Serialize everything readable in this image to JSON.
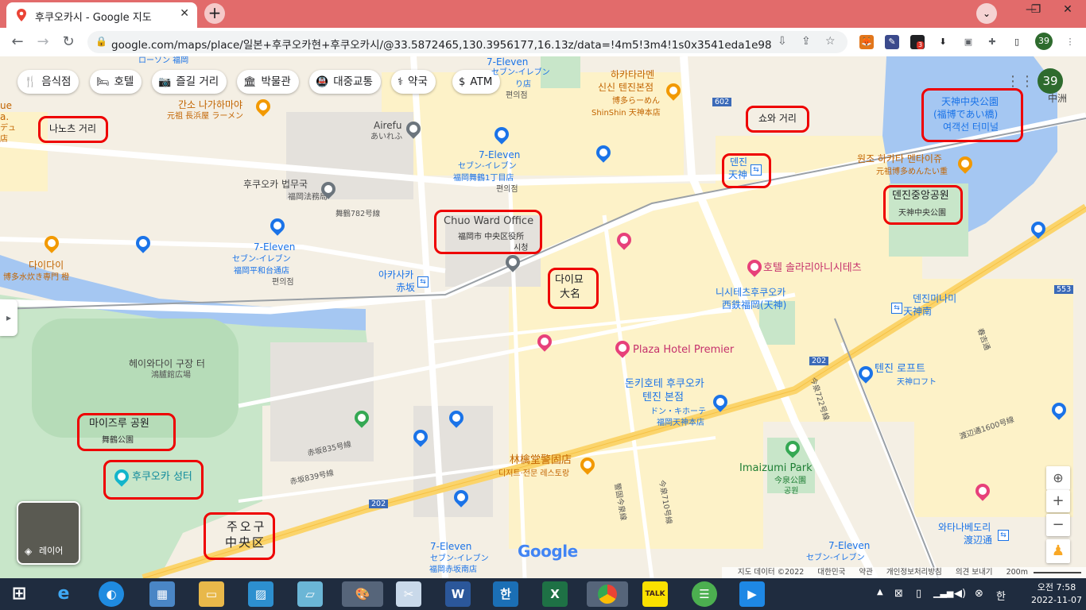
{
  "browser": {
    "tab_title": "후쿠오카시 - Google 지도",
    "url": "google.com/maps/place/일본+후쿠오카현+후쿠오카시/@33.5872465,130.3956177,16.13z/data=!4m5!3m4!1s0x3541eda1e984842...",
    "new_tab_label": "+",
    "profile_badge": "39",
    "ext_badge": "3"
  },
  "map": {
    "categories": [
      {
        "icon": "restaurant-icon",
        "label": "음식점"
      },
      {
        "icon": "hotel-icon",
        "label": "호텔"
      },
      {
        "icon": "camera-icon",
        "label": "즐길 거리"
      },
      {
        "icon": "museum-icon",
        "label": "박물관"
      },
      {
        "icon": "transit-icon",
        "label": "대중교통"
      },
      {
        "icon": "pharmacy-icon",
        "label": "약국"
      },
      {
        "icon": "atm-icon",
        "label": "ATM"
      }
    ],
    "account_badge": "39",
    "layers_label": "레이어",
    "labels": {
      "lawson": "ローソン 福岡",
      "kanso": "간소 나가하마야",
      "kanso_jp": "元祖 長浜屋 ラーメン",
      "nanotsu": "나노츠 거리",
      "airefu": "Airefu",
      "airefu_jp": "あいれふ",
      "eleven1": "7-Eleven",
      "eleven1_jp": "セブン-イレブン",
      "eleven1_sub": "り店",
      "eleven1_sub2": "편의점",
      "eleven2": "7-Eleven",
      "eleven2_jp": "セブン-イレブン",
      "eleven2_sub": "福岡舞鶴1丁目店",
      "eleven2_sub2": "편의점",
      "hakata_ramen": "하카타라멘",
      "shinshin": "신신 텐진본점",
      "shinshin_jp": "博多らーめん",
      "shinshin_en": "ShinShin 天神本店",
      "showa": "쇼와 거리",
      "tenjin_park": "天神中央公園",
      "tenjin_park2": "(福博であい橋)",
      "tenjin_park3": "여객선 터미널",
      "nakasu": "中洲",
      "tenjin_st": "덴진",
      "tenjin_st_jp": "天神",
      "ganso_hakata": "원조 하카타 멘타이쥬",
      "ganso_hakata_jp": "元祖博多めんたい重",
      "tenjin_central": "덴진중앙공원",
      "tenjin_central_jp": "天神中央公園",
      "legal_bureau": "후쿠오카 법무국",
      "legal_bureau_jp": "福岡法務局",
      "maizuru_road": "舞鶴782号線",
      "chuo_ward": "Chuo Ward Office",
      "chuo_ward_jp": "福岡市 中央区役所",
      "chuo_ward_ko": "시청",
      "eleven3": "7-Eleven",
      "eleven3_jp": "セブン-イレブン",
      "eleven3_sub": "福岡平和台通店",
      "eleven3_sub2": "편의점",
      "daidai": "다이다이",
      "daidai_jp": "博多水炊き専門 橙",
      "akasaka": "아카사카",
      "akasaka_jp": "赤坂",
      "daimyo": "다이묘",
      "daimyo_jp": "大名",
      "solaria": "호텔 솔라리아니시테츠",
      "nishitetsu": "니시테츠후쿠오카",
      "nishitetsu_jp": "西鉄福岡(天神)",
      "tenjin_minami": "덴진미나미",
      "tenjin_minami_jp": "天神南",
      "road553": "553",
      "road602": "602",
      "road202a": "202",
      "road202b": "202",
      "kasumi": "春吉通",
      "heiwadai": "헤이와다이 구장 터",
      "heiwadai_jp": "鴻臚館広場",
      "plaza": "Plaza Hotel Premier",
      "donki": "돈키호테 후쿠오카",
      "donki2": "텐진 본점",
      "donki_jp": "ドン・キホーテ",
      "donki_jp2": "福岡天神本店",
      "loft": "텐진 로프트",
      "loft_jp": "天神ロフト",
      "watanabe_road": "渡辺通1600号線",
      "imaizumi_road": "今泉722号線",
      "maizuru_park": "마이즈루 공원",
      "maizuru_park_jp": "舞鶴公園",
      "fukuoka_castle": "후쿠오카 성터",
      "akasaka835": "赤坂835号線",
      "akasaka839": "赤坂839号線",
      "rinkaku": "林檎堂警固店",
      "rinkaku_ko": "디저트·전문 레스토랑",
      "keigo": "警固今泉線",
      "imaizumi710": "今泉710号線",
      "imaizumi_park": "Imaizumi Park",
      "imaizumi_park_jp": "今泉公園",
      "imaizumi_park_ko": "공원",
      "watanabe_st": "와타나베도리",
      "watanabe_st_jp": "渡辺通",
      "chuo_ku": "주오구",
      "chuo_ku_jp": "中央区",
      "eleven4": "7-Eleven",
      "eleven4_jp": "セブン-イレブン",
      "eleven4_sub": "福岡赤坂南店",
      "eleven5": "7-Eleven",
      "eleven5_jp": "セブン-イレブン",
      "left_edge1": "ue",
      "left_edge2": "a.",
      "left_edge3": "デュ",
      "left_edge4": "店"
    },
    "google_logo": "Google",
    "footer": {
      "data": "지도 데이터 ©2022",
      "country": "대한민국",
      "terms": "약관",
      "privacy": "개인정보처리방침",
      "feedback": "의견 보내기",
      "scale": "200m"
    }
  },
  "taskbar": {
    "apps": [
      "start",
      "internet-explorer",
      "edge",
      "control-panel",
      "file-explorer",
      "photo-viewer",
      "notepad-like",
      "paint",
      "snipping",
      "word",
      "hangul",
      "excel",
      "chrome",
      "kakaotalk",
      "line-like",
      "media-player"
    ],
    "word_label": "W",
    "hangul_label": "한",
    "excel_label": "X",
    "kakao_label": "TALK",
    "ime_label": "한",
    "time": "오전 7:58",
    "date": "2022-11-07"
  }
}
